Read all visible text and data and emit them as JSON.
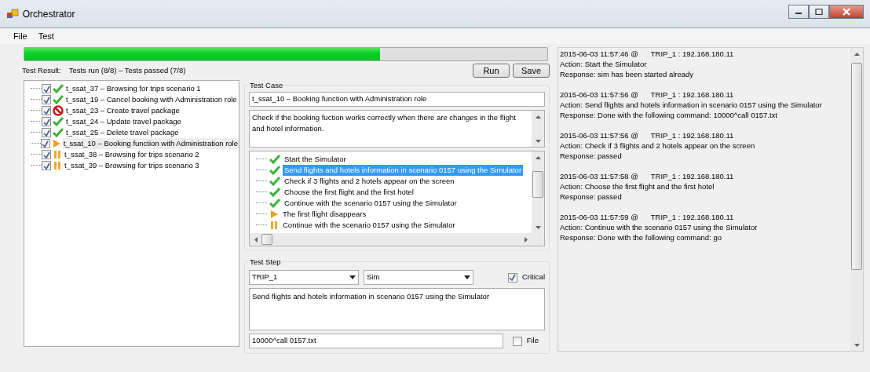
{
  "window": {
    "title": "Orchestrator"
  },
  "menu": [
    "File",
    "Test"
  ],
  "progress": {
    "level": 0.68
  },
  "result": {
    "label": "Test Result:",
    "text": "Tests run (8/8) – Tests passed (7/8)"
  },
  "buttons": [
    "Run",
    "Save"
  ],
  "tests": [
    {
      "label": "t_ssat_37 – Browsing for trips scenario 1",
      "checked": true,
      "kind": "passed",
      "selected": false
    },
    {
      "label": "t_ssat_19 – Cancel booking with Administration role",
      "checked": true,
      "kind": "passed",
      "selected": false
    },
    {
      "label": "t_ssat_23 – Create travel package",
      "checked": true,
      "kind": "failed",
      "selected": false
    },
    {
      "label": "t_ssat_24 – Update travel package",
      "checked": true,
      "kind": "passed",
      "selected": false
    },
    {
      "label": "t_ssat_25 – Delete travel package",
      "checked": true,
      "kind": "passed",
      "selected": false
    },
    {
      "label": "t_ssat_10 – Booking function with Administration role",
      "checked": true,
      "kind": "running",
      "selected": true
    },
    {
      "label": "t_ssat_38 – Browsing for trips scenario 2",
      "checked": true,
      "kind": "pending",
      "selected": false
    },
    {
      "label": "t_ssat_39 – Browsing for trips scenario 3",
      "checked": true,
      "kind": "pending",
      "selected": false
    }
  ],
  "test_case": {
    "title": "Test Case",
    "name": "t_ssat_10 – Booking function with Administration role",
    "description": "Check if the booking fuction works correctly when there are changes in the flight and hotel information.",
    "steps": [
      {
        "label": "Start the Simulator",
        "kind": "passed",
        "selected": false
      },
      {
        "label": "Send flights and hotels information in scenario 0157 using the Simulator",
        "kind": "passed",
        "selected": true
      },
      {
        "label": "Check if 3 flights and 2 hotels appear on the screen",
        "kind": "passed",
        "selected": false
      },
      {
        "label": "Choose the first flight and the first hotel",
        "kind": "passed",
        "selected": false
      },
      {
        "label": "Continue with the scenario 0157 using the Simulator",
        "kind": "passed",
        "selected": false
      },
      {
        "label": "The first flight disappears",
        "kind": "running",
        "selected": false
      },
      {
        "label": "Continue with the scenario 0157 using the Simulator",
        "kind": "pending",
        "selected": false
      }
    ]
  },
  "test_step": {
    "title": "Test Step",
    "target": "TRIP_1",
    "tool": "Sim",
    "critical": {
      "label": "Critical",
      "checked": true
    },
    "action": "Send flights and hotels information in scenario 0157 using the Simulator",
    "command": "10000^call 0157.txt",
    "file": {
      "label": "File",
      "checked": false
    }
  },
  "log": [
    {
      "time": "2015-06-03 11:57:46 @",
      "target": "TRIP_1 : 192.168.180.11",
      "action": "Action: Start the Simulator",
      "response": "Response: sim has been started already"
    },
    {
      "time": "2015-06-03 11:57:56 @",
      "target": "TRIP_1 : 192.168.180.11",
      "action": "Action: Send flights and hotels information in scenario 0157 using the Simulator",
      "response": "Response: Done with the following command: 10000^call 0157.txt"
    },
    {
      "time": "2015-06-03 11:57:56 @",
      "target": "TRIP_1 : 192.168.180.11",
      "action": "Action: Check if 3 flights and 2 hotels appear on the screen",
      "response": "Response: passed"
    },
    {
      "time": "2015-06-03 11:57:58 @",
      "target": "TRIP_1 : 192.168.180.11",
      "action": "Action: Choose the first flight and the first hotel",
      "response": "Response: passed"
    },
    {
      "time": "2015-06-03 11:57:59 @",
      "target": "TRIP_1 : 192.168.180.11",
      "action": "Action: Continue with the scenario 0157 using the Simulator",
      "response": "Response: Done with the following command: go"
    }
  ]
}
